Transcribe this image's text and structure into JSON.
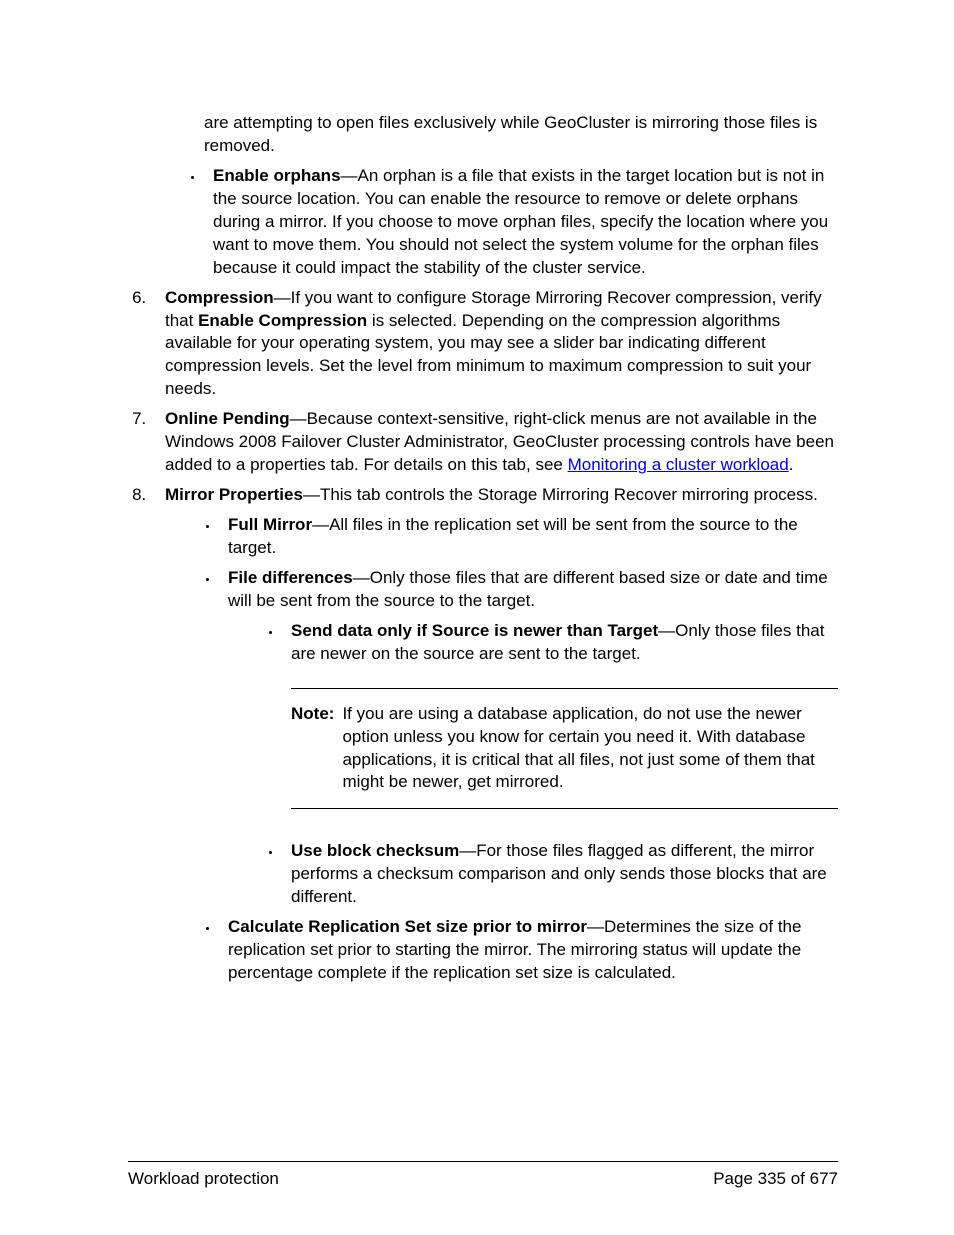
{
  "start_text": "are attempting to open files exclusively while GeoCluster is mirroring those files is removed.",
  "items_5": {
    "enable_orphans_bold": "Enable orphans",
    "enable_orphans_text": "—An orphan is a file that exists in the target location but is not in the source location. You can enable the resource to remove or delete orphans during a mirror. If you choose to move orphan files, specify the location where you want to move them. You should not select the system volume for the orphan files because it could impact the stability of the cluster service."
  },
  "item_6": {
    "bold": "Compression",
    "pre": "—If you want to configure Storage Mirroring Recover compression, verify that ",
    "mid_bold": "Enable Compression",
    "post": " is selected. Depending on the compression algorithms available for your operating system, you may see a slider bar indicating different compression levels. Set the level from minimum to maximum compression to suit your needs."
  },
  "item_7": {
    "bold": "Online Pending",
    "text": "—Because context-sensitive, right-click menus are not available in the Windows 2008 Failover Cluster Administrator, GeoCluster processing controls have been added to a properties tab. For details on this tab, see ",
    "link": "Monitoring a cluster workload",
    "period": "."
  },
  "item_8": {
    "bold": "Mirror Properties",
    "text": "—This tab controls the Storage Mirroring Recover mirroring process.",
    "sub": {
      "full_mirror_bold": "Full Mirror",
      "full_mirror_text": "—All files in the replication set will be sent from the source to the target.",
      "file_diff_bold": "File differences",
      "file_diff_text": "—Only those files that are different based size or date and time will be sent from the source to the target.",
      "send_newer_bold": "Send data only if Source is newer than Target",
      "send_newer_text": "—Only those files that are newer on the source are sent to the target.",
      "note_label": "Note:",
      "note_text": "If you are using a database application, do not use the newer option unless you know for certain you need it. With database applications, it is critical that all files, not just some of them that might be newer, get mirrored.",
      "checksum_bold": "Use block checksum",
      "checksum_text": "—For those files flagged as different, the mirror performs a checksum comparison and only sends those blocks that are different.",
      "calc_bold": "Calculate Replication Set size prior to mirror",
      "calc_text": "—Determines the size of the replication set prior to starting the mirror. The mirroring status will update the percentage complete if the replication set size is calculated."
    }
  },
  "footer": {
    "left": "Workload protection",
    "right": "Page 335 of 677"
  }
}
